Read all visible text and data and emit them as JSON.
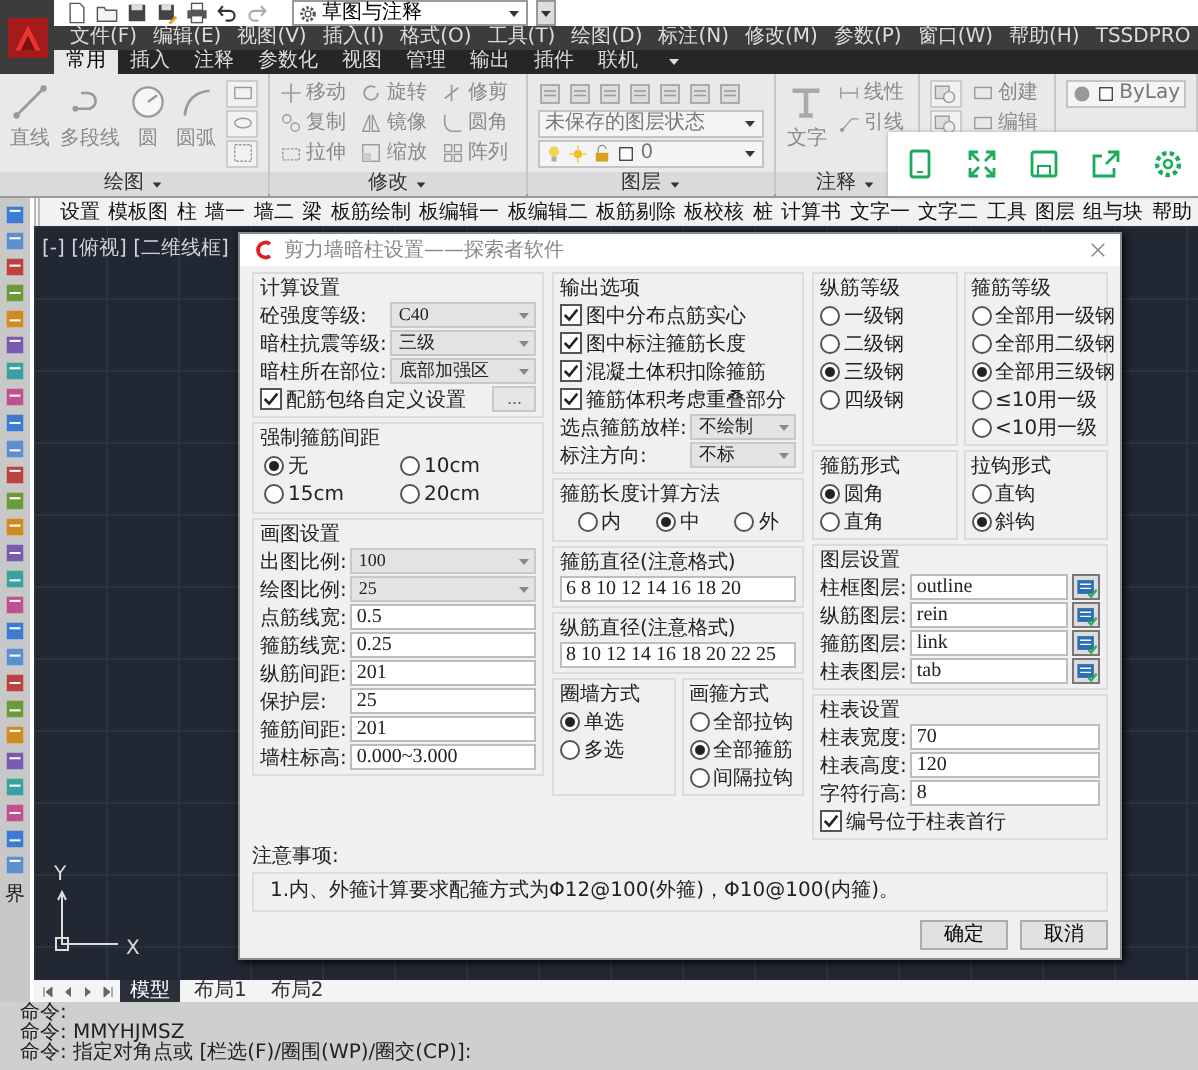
{
  "title_bar": {
    "workspace": "草图与注释"
  },
  "menu_bar": [
    "文件(F)",
    "编辑(E)",
    "视图(V)",
    "插入(I)",
    "格式(O)",
    "工具(T)",
    "绘图(D)",
    "标注(N)",
    "修改(M)",
    "参数(P)",
    "窗口(W)",
    "帮助(H)",
    "TSSDPRO"
  ],
  "ribbon_tabs": [
    {
      "label": "常用",
      "selected": true
    },
    {
      "label": "插入",
      "selected": false
    },
    {
      "label": "注释",
      "selected": false
    },
    {
      "label": "参数化",
      "selected": false
    },
    {
      "label": "视图",
      "selected": false
    },
    {
      "label": "管理",
      "selected": false
    },
    {
      "label": "输出",
      "selected": false
    },
    {
      "label": "插件",
      "selected": false
    },
    {
      "label": "联机",
      "selected": false
    }
  ],
  "ribbon_panels": [
    {
      "title": "绘图",
      "tools": [
        {
          "kind": "large",
          "label": "直线"
        },
        {
          "kind": "large",
          "label": "多段线"
        },
        {
          "kind": "large",
          "label": "圆"
        },
        {
          "kind": "large",
          "label": "圆弧"
        },
        {
          "kind": "iconbtn"
        },
        {
          "kind": "iconbtn"
        },
        {
          "kind": "iconbtn"
        }
      ]
    },
    {
      "title": "修改",
      "tools": [
        {
          "kind": "small",
          "label": "移动"
        },
        {
          "kind": "small",
          "label": "旋转"
        },
        {
          "kind": "small",
          "label": "修剪"
        },
        {
          "kind": "small",
          "label": "复制"
        },
        {
          "kind": "small",
          "label": "镜像"
        },
        {
          "kind": "small",
          "label": "圆角"
        },
        {
          "kind": "small",
          "label": "拉伸"
        },
        {
          "kind": "small",
          "label": "缩放"
        },
        {
          "kind": "small",
          "label": "阵列"
        }
      ]
    },
    {
      "title": "图层",
      "tools": [
        {
          "kind": "icons"
        },
        {
          "kind": "combo",
          "label": "未保存的图层状态"
        },
        {
          "kind": "layercombo",
          "label": "0"
        }
      ]
    },
    {
      "title": "注释",
      "tools": [
        {
          "kind": "large",
          "label": "文字"
        },
        {
          "kind": "small",
          "label": "线性"
        },
        {
          "kind": "small",
          "label": "引线"
        }
      ]
    },
    {
      "tools": [
        {
          "kind": "iconbtn"
        },
        {
          "kind": "small",
          "label": "创建"
        },
        {
          "kind": "iconbtn"
        },
        {
          "kind": "small",
          "label": "编辑"
        }
      ]
    },
    {
      "tools": [
        {
          "kind": "propcombo",
          "label": "ByLay"
        }
      ]
    }
  ],
  "plugin_toolbar": [
    "设置",
    "模板图",
    "柱",
    "墙一",
    "墙二",
    "梁",
    "板筋绘制",
    "板编辑一",
    "板编辑二",
    "板筋剔除",
    "板校核",
    "桩",
    "计算书",
    "文字一",
    "文字二",
    "工具",
    "图层",
    "组与块",
    "帮助"
  ],
  "left_toolbar_label": "界",
  "viewport_label": "[-] [俯视] [二维线框]",
  "ucs": {
    "x": "X",
    "y": "Y"
  },
  "dialog": {
    "title": "剪力墙暗柱设置——探索者软件",
    "columns": [
      [
        [
          {
            "title": "计算设置",
            "items": [
              {
                "kind": "combo",
                "label": "砼强度等级:",
                "value": "C40"
              },
              {
                "kind": "combo",
                "label": "暗柱抗震等级:",
                "value": "三级"
              },
              {
                "kind": "combo",
                "label": "暗柱所在部位:",
                "value": "底部加强区"
              },
              {
                "kind": "check",
                "label": "配筋包络自定义设置",
                "checked": true,
                "button": "..."
              }
            ]
          }
        ],
        [
          {
            "title": "强制箍筋间距",
            "kind": "grid",
            "items": [
              {
                "kind": "radio",
                "label": "无",
                "selected": true
              },
              {
                "kind": "radio",
                "label": "10cm",
                "selected": false
              },
              {
                "kind": "radio",
                "label": "15cm",
                "selected": false
              },
              {
                "kind": "radio",
                "label": "20cm",
                "selected": false
              }
            ]
          }
        ],
        [
          {
            "title": "画图设置",
            "items": [
              {
                "kind": "combo",
                "label": "出图比例:",
                "value": "100"
              },
              {
                "kind": "combo",
                "label": "绘图比例:",
                "value": "25"
              },
              {
                "kind": "text",
                "label": "点筋线宽:",
                "value": "0.5"
              },
              {
                "kind": "text",
                "label": "箍筋线宽:",
                "value": "0.25"
              },
              {
                "kind": "text",
                "label": "纵筋间距:",
                "value": "201"
              },
              {
                "kind": "text",
                "label": "保护层:",
                "value": "25"
              },
              {
                "kind": "text",
                "label": "箍筋间距:",
                "value": "201"
              },
              {
                "kind": "text",
                "label": "墙柱标高:",
                "value": "0.000~3.000"
              }
            ]
          }
        ]
      ],
      [
        [
          {
            "title": "输出选项",
            "items": [
              {
                "kind": "check",
                "label": "图中分布点筋实心",
                "checked": true
              },
              {
                "kind": "check",
                "label": "图中标注箍筋长度",
                "checked": true
              },
              {
                "kind": "check",
                "label": "混凝土体积扣除箍筋",
                "checked": true
              },
              {
                "kind": "check",
                "label": "箍筋体积考虑重叠部分",
                "checked": true
              },
              {
                "kind": "combo",
                "label": "选点箍筋放样:",
                "value": "不绘制"
              },
              {
                "kind": "combo",
                "label": "标注方向:",
                "value": "不标"
              }
            ]
          }
        ],
        [
          {
            "title": "箍筋长度计算方法",
            "kind": "row",
            "items": [
              {
                "kind": "radio",
                "label": "内",
                "selected": false
              },
              {
                "kind": "radio",
                "label": "中",
                "selected": true
              },
              {
                "kind": "radio",
                "label": "外",
                "selected": false
              }
            ]
          }
        ],
        [
          {
            "title": "箍筋直径(注意格式)",
            "items": [
              {
                "kind": "field",
                "value": "6 8 10 12 14 16 18 20"
              }
            ]
          }
        ],
        [
          {
            "title": "纵筋直径(注意格式)",
            "items": [
              {
                "kind": "field",
                "value": "8 10 12 14 16 18 20 22 25"
              }
            ]
          }
        ],
        [
          {
            "title": "圈墙方式",
            "items": [
              {
                "kind": "radio",
                "label": "单选",
                "selected": true
              },
              {
                "kind": "radio",
                "label": "多选",
                "selected": false
              }
            ]
          },
          {
            "title": "画箍方式",
            "items": [
              {
                "kind": "radio",
                "label": "全部拉钩",
                "selected": false
              },
              {
                "kind": "radio",
                "label": "全部箍筋",
                "selected": true
              },
              {
                "kind": "radio",
                "label": "间隔拉钩",
                "selected": false
              }
            ]
          }
        ]
      ],
      [
        [
          {
            "title": "纵筋等级",
            "items": [
              {
                "kind": "radio",
                "label": "一级钢",
                "selected": false
              },
              {
                "kind": "radio",
                "label": "二级钢",
                "selected": false
              },
              {
                "kind": "radio",
                "label": "三级钢",
                "selected": true
              },
              {
                "kind": "radio",
                "label": "四级钢",
                "selected": false
              }
            ]
          },
          {
            "title": "箍筋等级",
            "items": [
              {
                "kind": "radio",
                "label": "全部用一级钢",
                "selected": false
              },
              {
                "kind": "radio",
                "label": "全部用二级钢",
                "selected": false
              },
              {
                "kind": "radio",
                "label": "全部用三级钢",
                "selected": true
              },
              {
                "kind": "radio",
                "label": "≤10用一级",
                "selected": false
              },
              {
                "kind": "radio",
                "label": "<10用一级",
                "selected": false
              }
            ]
          }
        ],
        [
          {
            "title": "箍筋形式",
            "items": [
              {
                "kind": "radio",
                "label": "圆角",
                "selected": true
              },
              {
                "kind": "radio",
                "label": "直角",
                "selected": false
              }
            ]
          },
          {
            "title": "拉钩形式",
            "items": [
              {
                "kind": "radio",
                "label": "直钩",
                "selected": false
              },
              {
                "kind": "radio",
                "label": "斜钩",
                "selected": true
              }
            ]
          }
        ],
        [
          {
            "title": "图层设置",
            "items": [
              {
                "kind": "layer",
                "label": "柱框图层:",
                "value": "outline"
              },
              {
                "kind": "layer",
                "label": "纵筋图层:",
                "value": "rein"
              },
              {
                "kind": "layer",
                "label": "箍筋图层:",
                "value": "link"
              },
              {
                "kind": "layer",
                "label": "柱表图层:",
                "value": "tab"
              }
            ]
          }
        ],
        [
          {
            "title": "柱表设置",
            "items": [
              {
                "kind": "text",
                "label": "柱表宽度:",
                "value": "70"
              },
              {
                "kind": "text",
                "label": "柱表高度:",
                "value": "120"
              },
              {
                "kind": "text",
                "label": "字符行高:",
                "value": "8"
              },
              {
                "kind": "check",
                "label": "编号位于柱表首行",
                "checked": true
              }
            ]
          }
        ]
      ]
    ],
    "notes": {
      "title": "注意事项:",
      "text": "1.内、外箍计算要求配箍方式为Φ12@100(外箍)，Φ10@100(内箍)。"
    },
    "buttons": [
      "确定",
      "取消"
    ]
  },
  "layout_tabs": [
    {
      "label": "模型",
      "selected": true
    },
    {
      "label": "布局1",
      "selected": false
    },
    {
      "label": "布局2",
      "selected": false
    }
  ],
  "command_lines": [
    "命令:",
    "命令: MMYHJMSZ",
    "命令: 指定对角点或 [栏选(F)/圈围(WP)/圈交(CP)]:"
  ]
}
